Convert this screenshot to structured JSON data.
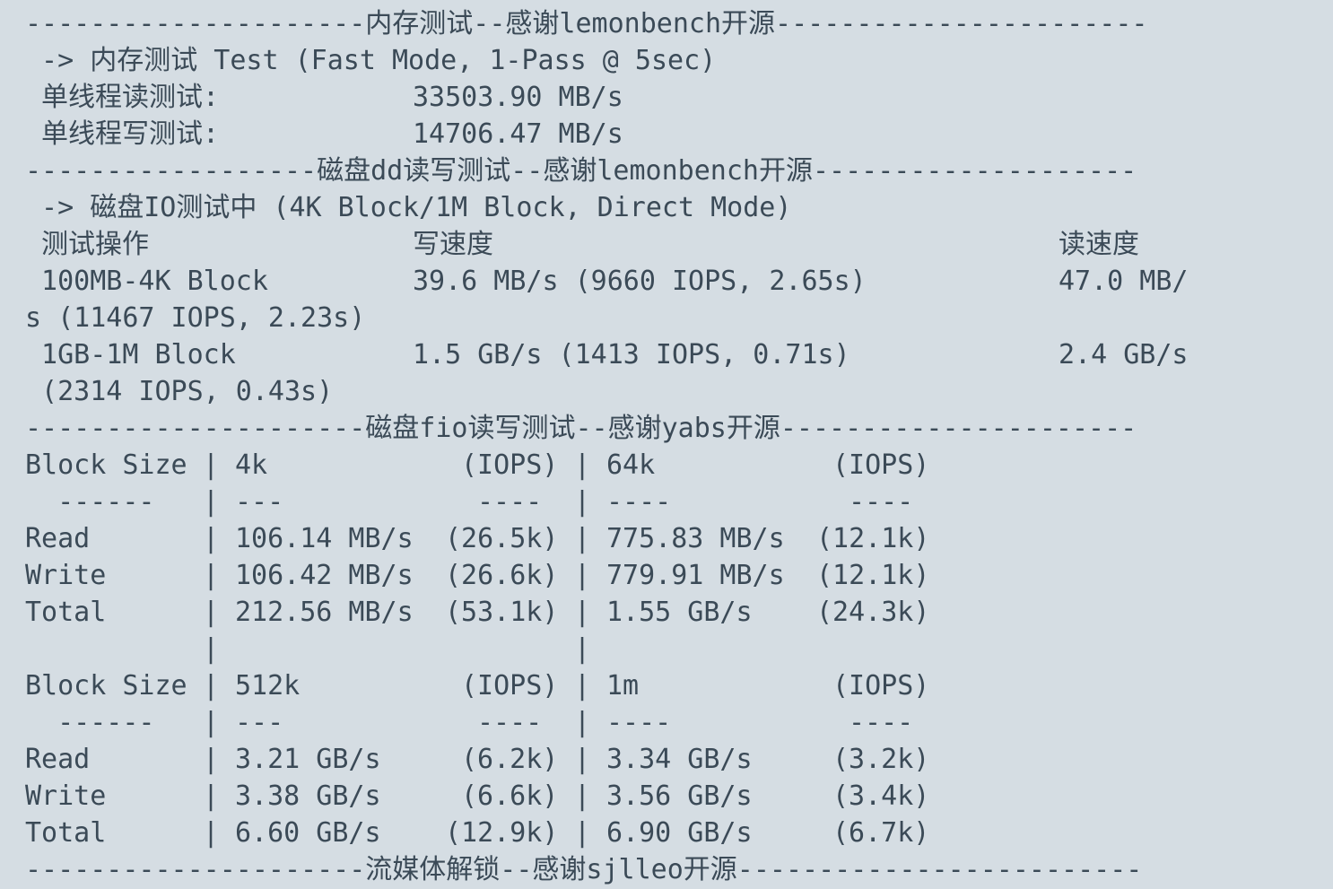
{
  "terminal": {
    "top_partial": "-- ---- ----- -",
    "sections": {
      "mem_header": "---------------------内存测试--感谢lemonbench开源-----------------------",
      "mem_title": " -> 内存测试 Test (Fast Mode, 1-Pass @ 5sec)",
      "mem_read_label": " 单线程读测试:",
      "mem_read_value": "33503.90 MB/s",
      "mem_write_label": " 单线程写测试:",
      "mem_write_value": "14706.47 MB/s",
      "dd_header": "------------------磁盘dd读写测试--感谢lemonbench开源--------------------",
      "dd_title": " -> 磁盘IO测试中 (4K Block/1M Block, Direct Mode)",
      "dd_col_op": " 测试操作",
      "dd_col_write": "写速度",
      "dd_col_read": "读速度",
      "dd_row1_op": " 100MB-4K Block",
      "dd_row1_write": "39.6 MB/s (9660 IOPS, 2.65s)",
      "dd_row1_read": "47.0 MB/",
      "dd_row1_wrap": "s (11467 IOPS, 2.23s)",
      "dd_row2_op": " 1GB-1M Block",
      "dd_row2_write": "1.5 GB/s (1413 IOPS, 0.71s)",
      "dd_row2_read": "2.4 GB/s",
      "dd_row2_wrap": " (2314 IOPS, 0.43s)",
      "fio_header": "---------------------磁盘fio读写测试--感谢yabs开源----------------------",
      "media_header": "---------------------流媒体解锁--感谢sjlleo开源-------------------------"
    },
    "fio_tables": [
      {
        "header": {
          "label": "Block Size",
          "a_size": "4k",
          "a_iops": "(IOPS)",
          "b_size": "64k",
          "b_iops": "(IOPS)"
        },
        "dashes": {
          "label": "  ------",
          "a_size": "---",
          "a_iops": "----",
          "b_size": "----",
          "b_iops": "----"
        },
        "rows": [
          {
            "label": "Read",
            "a_size": "106.14 MB/s",
            "a_iops": "(26.5k)",
            "b_size": "775.83 MB/s",
            "b_iops": "(12.1k)"
          },
          {
            "label": "Write",
            "a_size": "106.42 MB/s",
            "a_iops": "(26.6k)",
            "b_size": "779.91 MB/s",
            "b_iops": "(12.1k)"
          },
          {
            "label": "Total",
            "a_size": "212.56 MB/s",
            "a_iops": "(53.1k)",
            "b_size": "1.55 GB/s",
            "b_iops": "(24.3k)"
          }
        ]
      },
      {
        "header": {
          "label": "Block Size",
          "a_size": "512k",
          "a_iops": "(IOPS)",
          "b_size": "1m",
          "b_iops": "(IOPS)"
        },
        "dashes": {
          "label": "  ------",
          "a_size": "---",
          "a_iops": "----",
          "b_size": "----",
          "b_iops": "----"
        },
        "rows": [
          {
            "label": "Read",
            "a_size": "3.21 GB/s",
            "a_iops": "(6.2k)",
            "b_size": "3.34 GB/s",
            "b_iops": "(3.2k)"
          },
          {
            "label": "Write",
            "a_size": "3.38 GB/s",
            "a_iops": "(6.6k)",
            "b_size": "3.56 GB/s",
            "b_iops": "(3.4k)"
          },
          {
            "label": "Total",
            "a_size": "6.60 GB/s",
            "a_iops": "(12.9k)",
            "b_size": "6.90 GB/s",
            "b_iops": "(6.7k)"
          }
        ]
      }
    ],
    "pipe": "|"
  }
}
